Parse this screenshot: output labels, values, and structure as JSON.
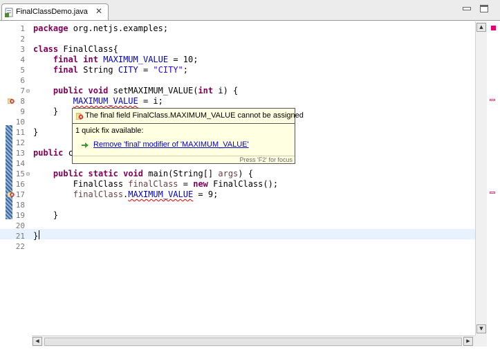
{
  "tab": {
    "title": "FinalClassDemo.java",
    "close": "✕",
    "icon": "java-file-icon"
  },
  "window_controls": {
    "minimize_icon": "minimize-icon",
    "maximize_icon": "maximize-icon"
  },
  "editor": {
    "line_numbers": [
      "1",
      "2",
      "3",
      "4",
      "5",
      "6",
      "7",
      "8",
      "9",
      "10",
      "11",
      "12",
      "13",
      "14",
      "15",
      "16",
      "17",
      "18",
      "19",
      "20",
      "21",
      "22"
    ],
    "fold_markers": {
      "7": "⊖",
      "15": "⊖"
    },
    "code": {
      "l1_kw": "package",
      "l1_rest": " org.netjs.examples;",
      "l3_kw": "class",
      "l3_rest": " FinalClass{",
      "l4_kw1": "final",
      "l4_kw2": "int",
      "l4_fld": "MAXIMUM_VALUE",
      "l4_rest": " = 10;",
      "l5_kw": "final",
      "l5_mid": " String ",
      "l5_fld": "CITY",
      "l5_eq": " = ",
      "l5_str": "\"CITY\"",
      "l5_end": ";",
      "l7_kw1": "public",
      "l7_kw2": "void",
      "l7_mid": " setMAXIMUM_VALUE(",
      "l7_kw3": "int",
      "l7_end": " i) {",
      "l8_fld": "MAXIMUM_VALUE",
      "l8_rest": " = i;",
      "l9": "}",
      "l11": "}",
      "l13_kw": "public",
      "l13_rest": " c",
      "l15_kw1": "public",
      "l15_kw2": "static",
      "l15_kw3": "void",
      "l15_mid": " main(String[] ",
      "l15_loc": "args",
      "l15_end": ") {",
      "l16_a": "FinalClass ",
      "l16_loc": "finalClass",
      "l16_b": " = ",
      "l16_kw": "new",
      "l16_c": " FinalClass();",
      "l17_loc": "finalClass",
      "l17_dot": ".",
      "l17_fld": "MAXIMUM_VALUE",
      "l17_rest": " = 9;",
      "l19": "}",
      "l21": "}"
    },
    "error_marker_icon": "error-marker-icon"
  },
  "popup": {
    "message": "The final field FinalClass.MAXIMUM_VALUE cannot be assigned",
    "fix_count": "1 quick fix available:",
    "fix_label": "Remove 'final' modifier of 'MAXIMUM_VALUE'",
    "hint": "Press 'F2' for focus",
    "error_icon": "error-icon",
    "fix_icon": "quick-fix-icon"
  },
  "scrollbars": {
    "up": "▲",
    "down": "▼",
    "left": "◀",
    "right": "▶"
  },
  "colors": {
    "keyword": "#7f0055",
    "field": "#0000c0",
    "string": "#2a00ff",
    "error": "#e00000",
    "popup_bg": "#ffffe1",
    "current_line": "#e8f2fe"
  }
}
